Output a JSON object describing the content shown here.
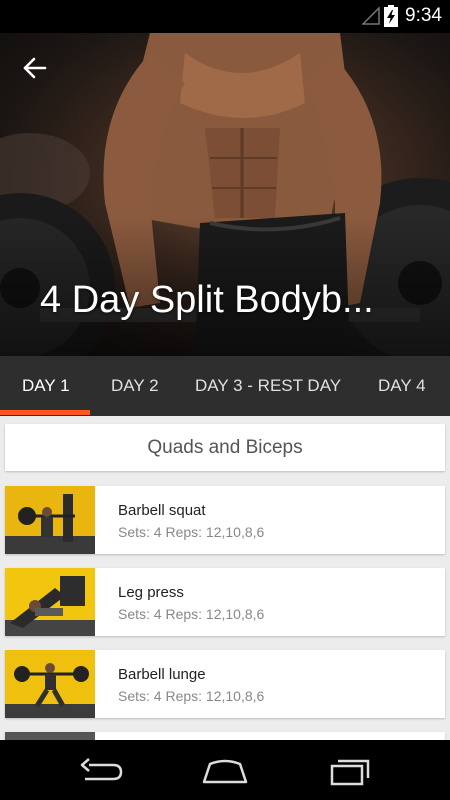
{
  "status_bar": {
    "time": "9:34"
  },
  "header": {
    "title": "4 Day Split Bodyb..."
  },
  "tabs": [
    {
      "label": "DAY 1",
      "active": true
    },
    {
      "label": "DAY 2",
      "active": false
    },
    {
      "label": "DAY 3  - REST DAY",
      "active": false
    },
    {
      "label": "DAY 4",
      "active": false
    }
  ],
  "section": {
    "title": "Quads and Biceps"
  },
  "exercises": [
    {
      "name": "Barbell squat",
      "meta": "Sets: 4  Reps: 12,10,8,6"
    },
    {
      "name": "Leg press",
      "meta": "Sets: 4  Reps: 12,10,8,6"
    },
    {
      "name": "Barbell lunge",
      "meta": "Sets: 4  Reps: 12,10,8,6"
    }
  ],
  "colors": {
    "accent": "#ff5722",
    "tab_bar": "#2e2e2e",
    "thumb_bg": "#f2c50f"
  },
  "icons": {
    "back": "back-arrow-icon",
    "nav": [
      "nav-back-icon",
      "nav-home-icon",
      "nav-recents-icon"
    ]
  }
}
